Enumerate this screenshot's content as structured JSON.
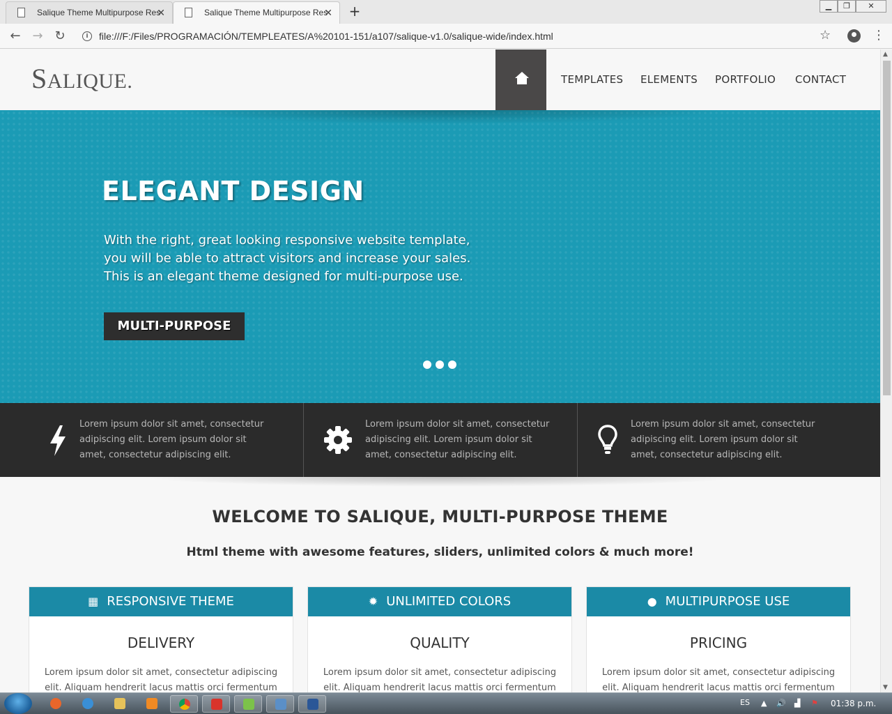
{
  "browser": {
    "tabs": [
      {
        "title": "Salique Theme Multipurpose Res"
      },
      {
        "title": "Salique Theme Multipurpose Res"
      }
    ],
    "new_tab_label": "+",
    "url": "file:///F:/Files/PROGRAMACIÓN/TEMPLEATES/A%20101-151/a107/salique-v1.0/salique-wide/index.html"
  },
  "site": {
    "logo": {
      "first": "S",
      "rest": "ALIQUE."
    },
    "nav": [
      "TEMPLATES",
      "ELEMENTS",
      "PORTFOLIO",
      "CONTACT"
    ]
  },
  "hero": {
    "title": "ELEGANT DESIGN",
    "text": "With the right, great looking responsive website template, you will be able to attract visitors and increase your sales. This is an elegant theme designed for multi-purpose use.",
    "button": "MULTI-PURPOSE",
    "slide_count": 3,
    "background_color": "#1b9bb5"
  },
  "features": [
    {
      "icon": "lightning-bolt-icon",
      "text": "Lorem ipsum dolor sit amet, consectetur adipiscing elit. Lorem ipsum dolor sit amet, consectetur adipiscing elit."
    },
    {
      "icon": "gear-icon",
      "text": "Lorem ipsum dolor sit amet, consectetur adipiscing elit. Lorem ipsum dolor sit amet, consectetur adipiscing elit."
    },
    {
      "icon": "lightbulb-icon",
      "text": "Lorem ipsum dolor sit amet, consectetur adipiscing elit. Lorem ipsum dolor sit amet, consectetur adipiscing elit."
    }
  ],
  "welcome": {
    "title": "WELCOME TO SALIQUE, MULTI-PURPOSE THEME",
    "subtitle": "Html theme with awesome features, sliders, unlimited colors & much more!"
  },
  "cards": [
    {
      "icon": "qr-code-icon",
      "header": "RESPONSIVE THEME",
      "title": "DELIVERY",
      "body": "Lorem ipsum dolor sit amet, consectetur adipiscing elit. Aliquam hendrerit lacus mattis orci fermentum mollis"
    },
    {
      "icon": "gear-icon",
      "header": "UNLIMITED COLORS",
      "title": "QUALITY",
      "body": "Lorem ipsum dolor sit amet, consectetur adipiscing elit. Aliquam hendrerit lacus mattis orci fermentum mollis"
    },
    {
      "icon": "user-icon",
      "header": "MULTIPURPOSE USE",
      "title": "PRICING",
      "body": "Lorem ipsum dolor sit amet, consectetur adipiscing elit. Aliquam hendrerit lacus mattis orci fermentum mollis"
    }
  ],
  "taskbar": {
    "language": "ES",
    "time": "01:38 p.m."
  },
  "colors": {
    "accent": "#1b8aa6",
    "dark_bar": "#2b2b2b",
    "home_button": "#4a4848"
  }
}
